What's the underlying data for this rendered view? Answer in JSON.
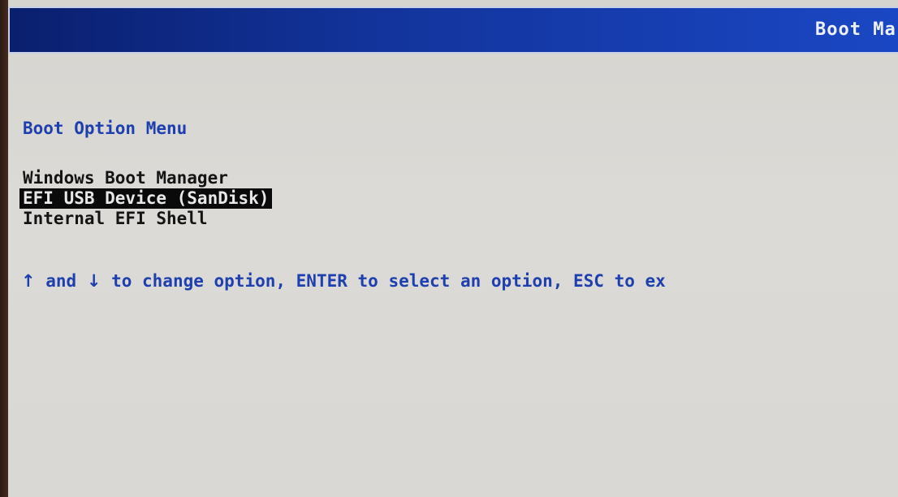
{
  "header": {
    "title": "Boot Mar"
  },
  "menu": {
    "title": "Boot Option Menu",
    "options": [
      {
        "label": "Windows Boot Manager",
        "selected": false
      },
      {
        "label": "EFI USB Device (SanDisk)",
        "selected": true
      },
      {
        "label": "Internal EFI Shell",
        "selected": false
      }
    ]
  },
  "hint": {
    "up_arrow": "↑",
    "and": " and ",
    "down_arrow": "↓",
    "text": " to change option, ENTER to select an option, ESC to ex"
  },
  "colors": {
    "header_blue": "#12339a",
    "text_blue": "#1e3fae",
    "selection_bg": "#0a0a0a",
    "screen_bg": "#d9d8d4"
  }
}
